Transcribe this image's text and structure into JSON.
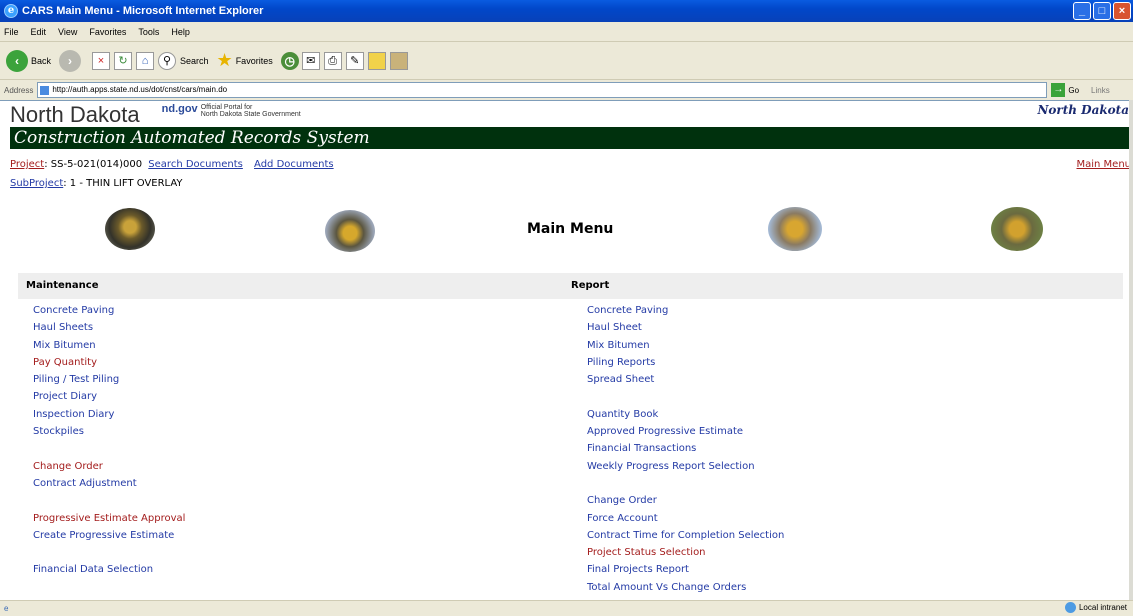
{
  "window": {
    "title": "CARS Main Menu - Microsoft Internet Explorer"
  },
  "menubar": [
    "File",
    "Edit",
    "View",
    "Favorites",
    "Tools",
    "Help"
  ],
  "toolbar": {
    "back": "Back",
    "search": "Search",
    "favorites": "Favorites"
  },
  "addressbar": {
    "label": "Address",
    "url": "http://auth.apps.state.nd.us/dot/cnst/cars/main.do",
    "go": "Go",
    "links": "Links"
  },
  "header": {
    "state": "North Dakota",
    "ndgov": "nd.gov",
    "portal_line1": "Official Portal for",
    "portal_line2": "North Dakota State Government",
    "logo": "North Dakota",
    "banner": "Construction Automated Records System"
  },
  "project": {
    "project_label": "Project",
    "project_value": ": SS-5-021(014)000",
    "search_docs": "Search Documents",
    "add_docs": "Add Documents",
    "main_menu_link": "Main Menu",
    "subproject_label": "SubProject",
    "subproject_value": ": 1 - THIN LIFT OVERLAY"
  },
  "page_title": "Main Menu",
  "maintenance": {
    "heading": "Maintenance",
    "items": [
      {
        "label": "Concrete Paving",
        "color": "#233aa5"
      },
      {
        "label": "Haul Sheets",
        "color": "#233aa5"
      },
      {
        "label": "Mix Bitumen",
        "color": "#233aa5"
      },
      {
        "label": "Pay Quantity",
        "color": "#a31c1c"
      },
      {
        "label": "Piling / Test Piling",
        "color": "#233aa5"
      },
      {
        "label": "Project Diary",
        "color": "#233aa5"
      },
      {
        "label": "Inspection Diary",
        "color": "#233aa5"
      },
      {
        "label": "Stockpiles",
        "color": "#233aa5"
      },
      {
        "label": "",
        "color": ""
      },
      {
        "label": "Change Order",
        "color": "#a31c1c"
      },
      {
        "label": "Contract Adjustment",
        "color": "#233aa5"
      },
      {
        "label": "",
        "color": ""
      },
      {
        "label": "Progressive Estimate Approval",
        "color": "#a31c1c"
      },
      {
        "label": "Create Progressive Estimate",
        "color": "#233aa5"
      },
      {
        "label": "",
        "color": ""
      },
      {
        "label": "Financial Data Selection",
        "color": "#233aa5"
      }
    ]
  },
  "report": {
    "heading": "Report",
    "items": [
      {
        "label": "Concrete Paving",
        "color": "#233aa5"
      },
      {
        "label": "Haul Sheet",
        "color": "#233aa5"
      },
      {
        "label": "Mix Bitumen",
        "color": "#233aa5"
      },
      {
        "label": "Piling Reports",
        "color": "#233aa5"
      },
      {
        "label": "Spread Sheet",
        "color": "#233aa5"
      },
      {
        "label": "",
        "color": ""
      },
      {
        "label": "Quantity Book",
        "color": "#233aa5"
      },
      {
        "label": "Approved Progressive Estimate",
        "color": "#233aa5"
      },
      {
        "label": "Financial Transactions",
        "color": "#233aa5"
      },
      {
        "label": "Weekly Progress Report Selection",
        "color": "#233aa5"
      },
      {
        "label": "",
        "color": ""
      },
      {
        "label": "Change Order",
        "color": "#233aa5"
      },
      {
        "label": "Force Account",
        "color": "#233aa5"
      },
      {
        "label": "Contract Time for Completion Selection",
        "color": "#233aa5"
      },
      {
        "label": "Project Status Selection",
        "color": "#a31c1c"
      },
      {
        "label": "Final Projects Report",
        "color": "#233aa5"
      },
      {
        "label": "Total Amount Vs Change Orders",
        "color": "#233aa5"
      }
    ]
  },
  "status": {
    "zone": "Local intranet"
  }
}
